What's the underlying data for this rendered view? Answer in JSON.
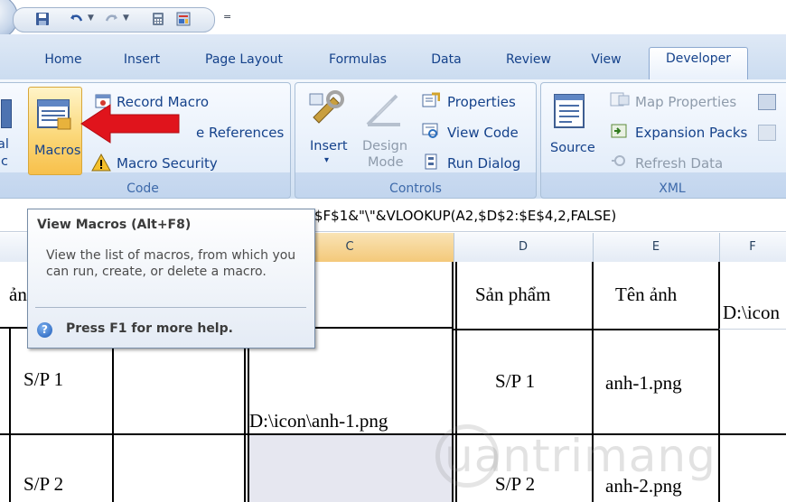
{
  "quick_access": {
    "more_label": "="
  },
  "tabs": [
    "Home",
    "Insert",
    "Page Layout",
    "Formulas",
    "Data",
    "Review",
    "View",
    "Developer"
  ],
  "ribbon": {
    "code": {
      "left_partial_1": "al",
      "left_partial_2": "c",
      "macros_label": "Macros",
      "record_macro": "Record Macro",
      "use_relative_partial": "e References",
      "macro_security": "Macro Security",
      "group_label": "Code"
    },
    "controls": {
      "insert_label": "Insert",
      "design_mode_label_1": "Design",
      "design_mode_label_2": "Mode",
      "properties": "Properties",
      "view_code": "View Code",
      "run_dialog": "Run Dialog",
      "group_label": "Controls"
    },
    "xml": {
      "source_label": "Source",
      "map_properties": "Map Properties",
      "expansion_packs": "Expansion Packs",
      "refresh_data": "Refresh Data",
      "group_label": "XML"
    }
  },
  "formula_bar": {
    "text": "$F$1&\"\\\"&VLOOKUP(A2,$D$2:$E$4,2,FALSE)"
  },
  "columns": [
    "C",
    "D",
    "E",
    "F"
  ],
  "grid": {
    "row1": {
      "a": "ản",
      "d": "Sản phẩm",
      "e": "Tên ảnh",
      "f": "D:\\icon"
    },
    "row2": {
      "a": "S/P 1",
      "c": "D:\\icon\\anh-1.png",
      "d": "S/P 1",
      "e": "anh-1.png"
    },
    "row3": {
      "a": "S/P 2",
      "d": "S/P 2",
      "e": "anh-2.png"
    }
  },
  "tooltip": {
    "title": "View Macros (Alt+F8)",
    "body": "View the list of macros, from which you can run, create, or delete a macro.",
    "help": "Press F1 for more help."
  },
  "watermark": "uantrimang",
  "colors": {
    "accent_red": "#e0141c",
    "ribbon_blue": "#15428b",
    "selected_button": "#fbd87a"
  }
}
